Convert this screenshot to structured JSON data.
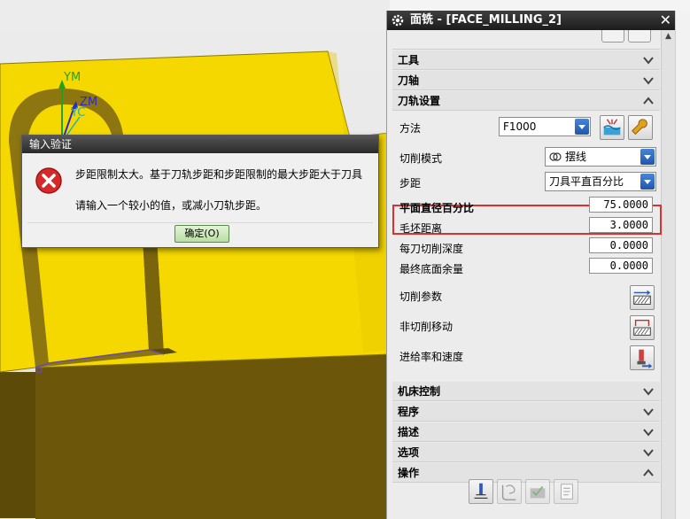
{
  "viewport": {
    "axes": {
      "ym": "YM",
      "zm": "ZM",
      "yc": "YC"
    }
  },
  "dialog": {
    "title": "输入验证",
    "message_line1": "步距限制太大。基于刀轨步距和步距限制的最大步距大于刀具",
    "message_line2": "请输入一个较小的值，或减小刀轨步距。",
    "ok_label": "确定(O)"
  },
  "panel": {
    "title": "面铣 - [FACE_MILLING_2]",
    "close_glyph": "✕",
    "sections": {
      "tool": "工具",
      "axis": "刀轴",
      "path_settings": "刀轨设置",
      "machine_control": "机床控制",
      "program": "程序",
      "description": "描述",
      "options": "选项",
      "actions": "操作"
    },
    "method": {
      "label": "方法",
      "value": "F1000"
    },
    "cut_pattern": {
      "label": "切削模式",
      "value": "摆线"
    },
    "stepover": {
      "label": "步距",
      "value": "刀具平直百分比"
    },
    "flat_diameter_percent": {
      "label": "平面直径百分比",
      "value": "75.0000"
    },
    "blank_distance": {
      "label": "毛坯距离",
      "value": "3.0000"
    },
    "depth_per_cut": {
      "label": "每刀切削深度",
      "value": "0.0000"
    },
    "final_floor_stock": {
      "label": "最终底面余量",
      "value": "0.0000"
    },
    "cutting_params": {
      "label": "切削参数"
    },
    "non_cutting_moves": {
      "label": "非切削移动"
    },
    "feeds_speeds": {
      "label": "进给率和速度"
    }
  },
  "colors": {
    "part_yellow": "#f5d800",
    "part_dark": "#6e5a0a",
    "highlight": "#d93030"
  }
}
